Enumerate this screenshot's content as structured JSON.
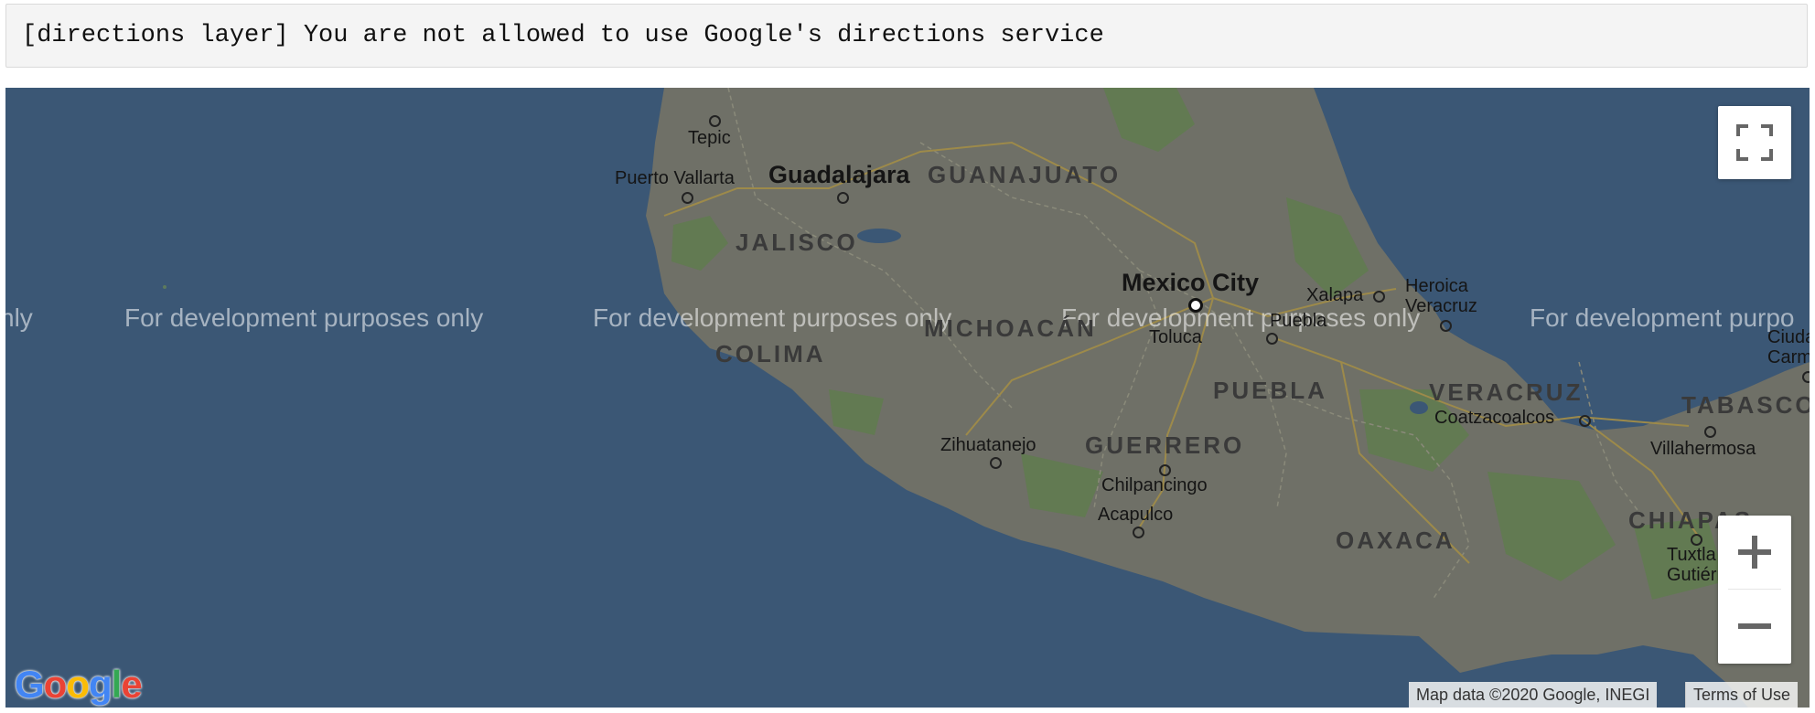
{
  "error_message": "[directions layer] You are not allowed to use Google's directions service",
  "map": {
    "watermark_text": "For development purposes only",
    "watermark_fragment_left": "nly",
    "watermark_fragment_right": "For development purpo",
    "cities": {
      "tepic": "Tepic",
      "puerto_vallarta": "Puerto Vallarta",
      "guadalajara": "Guadalajara",
      "mexico_city": "Mexico City",
      "xalapa": "Xalapa",
      "heroica_veracruz": "Heroica\nVeracruz",
      "toluca": "Toluca",
      "puebla": "Puebla",
      "zihuatanejo": "Zihuatanejo",
      "chilpancingo": "Chilpancingo",
      "acapulco": "Acapulco",
      "coatzacoalcos": "Coatzacoalcos",
      "villahermosa": "Villahermosa",
      "tuxtla": "Tuxtla\nGutiérr",
      "ciudad_carm": "Ciuda\nCarm"
    },
    "states": {
      "guanajuato": "GUANAJUATO",
      "jalisco": "JALISCO",
      "michoacan": "MICHOACÁN",
      "colima": "COLIMA",
      "puebla": "PUEBLA",
      "veracruz": "VERACRUZ",
      "guerrero": "GUERRERO",
      "oaxaca": "OAXACA",
      "tabasco": "TABASCO",
      "chiapas": "CHIAPAS"
    },
    "controls": {
      "fullscreen_icon": "fullscreen-icon",
      "zoom_in_icon": "plus-icon",
      "zoom_out_icon": "minus-icon"
    },
    "attribution": "Map data ©2020 Google, INEGI",
    "terms": "Terms of Use",
    "logo": {
      "letters": [
        "G",
        "o",
        "o",
        "g",
        "l",
        "e"
      ],
      "colors": [
        "#4285f4",
        "#ea4335",
        "#fbbc05",
        "#4285f4",
        "#34a853",
        "#ea4335"
      ]
    },
    "colors": {
      "water": "#3b5775",
      "land": "#6f7067",
      "vegetation": "#627a52"
    }
  }
}
